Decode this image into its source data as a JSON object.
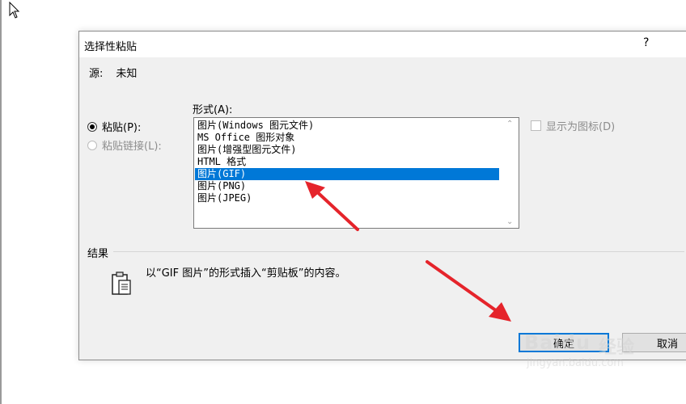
{
  "dialog": {
    "title": "选择性粘贴",
    "help": "?",
    "source_label": "源:",
    "source_value": "未知",
    "paste_label": "粘贴(P):",
    "paste_link_label": "粘贴链接(L):",
    "format_label": "形式(A):",
    "formats": [
      "图片(Windows 图元文件)",
      "MS Office 图形对象",
      "图片(增强型图元文件)",
      "HTML 格式",
      "图片(GIF)",
      "图片(PNG)",
      "图片(JPEG)"
    ],
    "selected_format_index": 4,
    "display_as_icon_label": "显示为图标(D)",
    "result_label": "结果",
    "result_text": "以“GIF 图片”的形式插入“剪贴板”的内容。",
    "ok_label": "确定",
    "cancel_label": "取消"
  },
  "watermark": {
    "brand": "Baidu",
    "product": "经验",
    "url": "jingyan.baidu.com"
  },
  "colors": {
    "selection": "#0078d7",
    "annotation_arrow": "#e5242b",
    "dialog_bg": "#f0f0f0"
  }
}
